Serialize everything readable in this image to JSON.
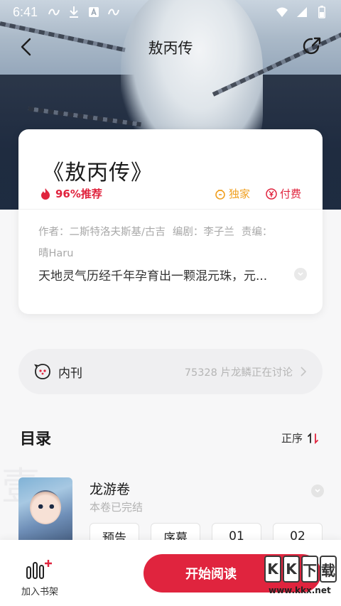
{
  "status_bar": {
    "time": "6:41",
    "icons": [
      "sync-icon",
      "download-icon",
      "a-icon",
      "sync-icon"
    ],
    "right_icons": [
      "wifi-icon",
      "signal-icon",
      "battery-icon"
    ]
  },
  "nav": {
    "title": "敖丙传"
  },
  "book": {
    "title": "《敖丙传》",
    "recommend": "96%推荐",
    "tag_exclusive": "独家",
    "tag_paid": "付费",
    "author_label": "作者：二斯特洛夫斯基/古吉",
    "writer_label": "编剧：李子兰",
    "editor_label": "责编：",
    "editor_name": "晴Haru",
    "summary": "天地灵气历经千年孕育出一颗混元珠，元..."
  },
  "community": {
    "label": "内刊",
    "text": "75328 片龙鳞正在讨论"
  },
  "catalog": {
    "title": "目录",
    "sort_label": "正序",
    "watermark": "壹",
    "volume": {
      "title": "龙游卷",
      "status": "本卷已完结",
      "chapters": [
        "预告",
        "序幕",
        "01",
        "02"
      ]
    }
  },
  "bottom": {
    "add_shelf": "加入书架",
    "start_reading": "开始阅读"
  },
  "watermark_logo": {
    "letters": [
      "K",
      "K",
      "下",
      "载"
    ],
    "url": "www.kkx.net"
  },
  "colors": {
    "accent": "#e0243e",
    "exclusive": "#f0a021"
  }
}
